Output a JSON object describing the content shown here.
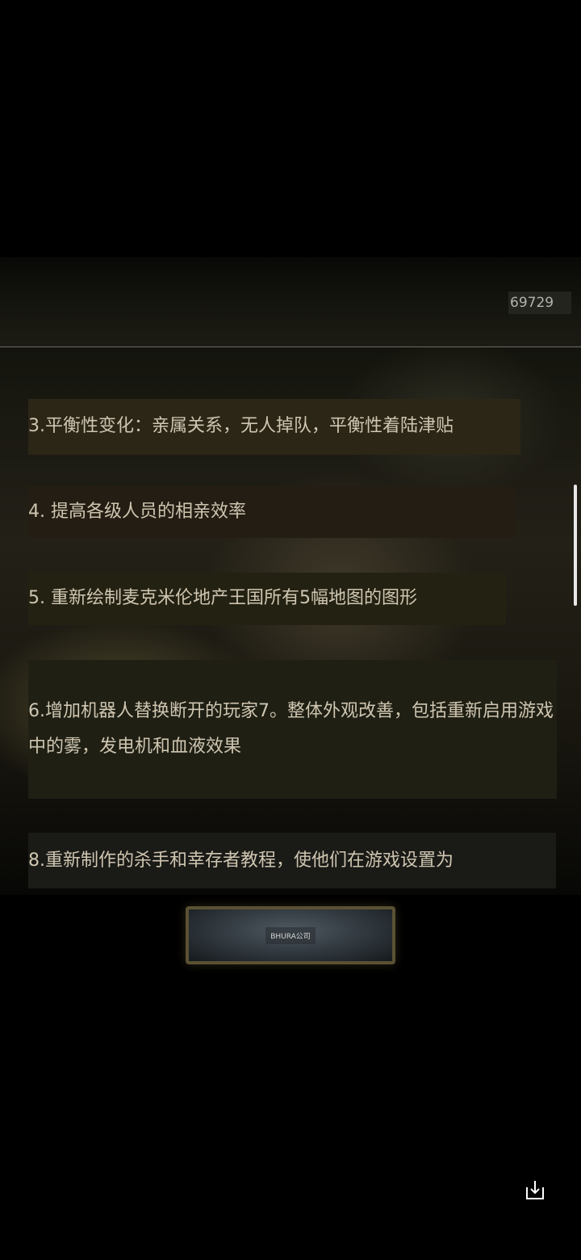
{
  "header": {
    "id_label": "69729"
  },
  "notes": [
    {
      "text": "3.平衡性变化：亲属关系，无人掉队，平衡性着陆津贴"
    },
    {
      "text": "4. 提高各级人员的相亲效率"
    },
    {
      "text": "5. 重新绘制麦克米伦地产王国所有5幅地图的图形"
    },
    {
      "text": "6.增加机器人替换断开的玩家7。整体外观改善，包括重新启用游戏中的雾，发电机和血液效果"
    },
    {
      "text": "8.重新制作的杀手和幸存者教程，使他们在游戏设置为"
    }
  ],
  "company_button": {
    "label": "BHURA公司"
  },
  "icons": {
    "download": "download-icon"
  },
  "colors": {
    "background": "#000000",
    "note_text": "#cfc6b1",
    "button_border": "#5a5133"
  }
}
